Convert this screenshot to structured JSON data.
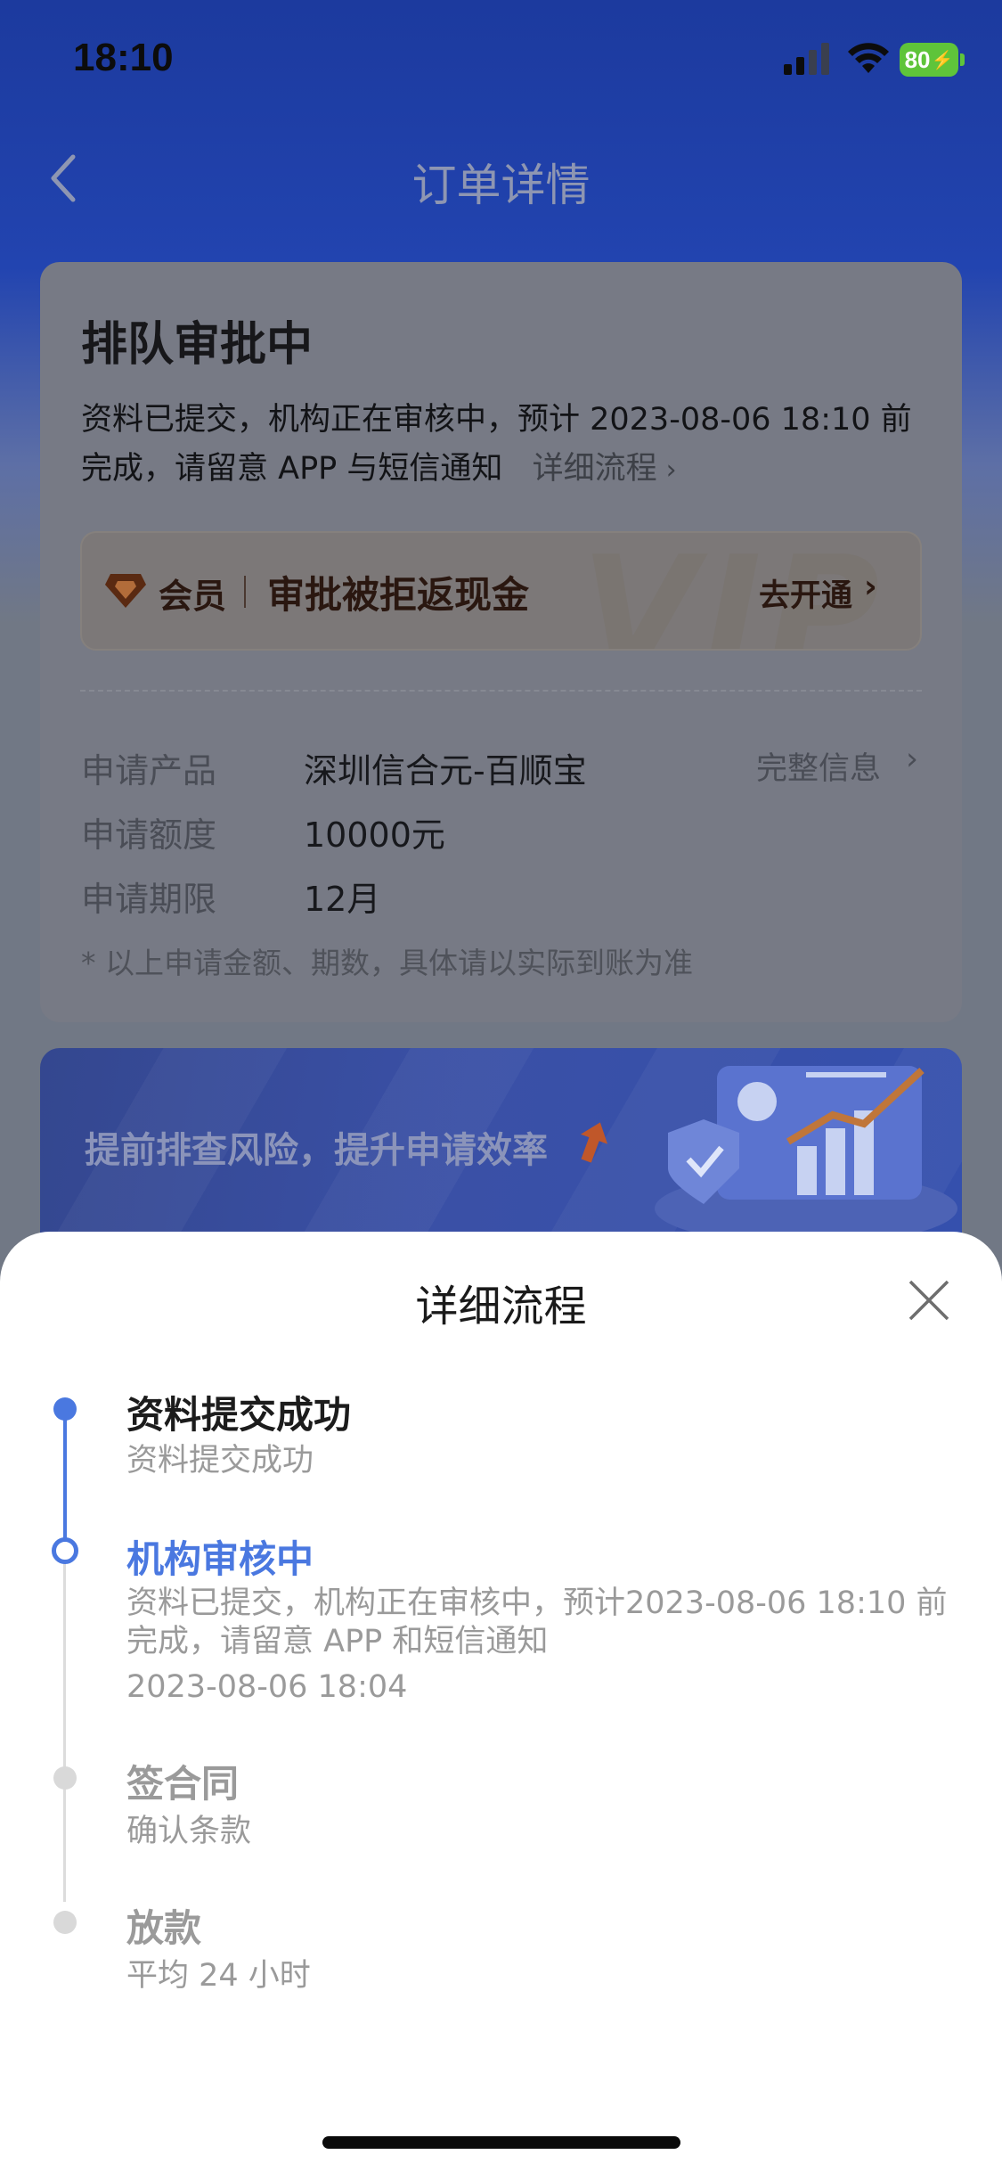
{
  "status_bar": {
    "time": "18:10",
    "battery": "80",
    "icons": [
      "signal-icon",
      "wifi-icon",
      "battery-icon"
    ]
  },
  "nav": {
    "title": "订单详情",
    "back_icon": "chevron-left-icon"
  },
  "order": {
    "status_title": "排队审批中",
    "status_desc": "资料已提交，机构正在审核中，预计 2023-08-06 18:10 前完成，请留意 APP 与短信通知",
    "detail_link": "详细流程",
    "vip": {
      "label": "会员",
      "text": "审批被拒返现金",
      "cta": "去开通",
      "watermark": "VIP",
      "icon": "diamond-icon"
    },
    "info": [
      {
        "key": "申请产品",
        "value": "深圳信合元-百顺宝"
      },
      {
        "key": "申请额度",
        "value": "10000元"
      },
      {
        "key": "申请期限",
        "value": "12月"
      }
    ],
    "full_info_link": "完整信息",
    "note": "* 以上申请金额、期数，具体请以实际到账为准"
  },
  "promo": {
    "text": "提前排查风险，提升申请效率"
  },
  "sheet": {
    "title": "详细流程",
    "steps": [
      {
        "title": "资料提交成功",
        "desc": "资料提交成功",
        "state": "done"
      },
      {
        "title": "机构审核中",
        "desc": "资料已提交，机构正在审核中，预计2023-08-06 18:10 前完成，请留意 APP 和短信通知",
        "time": "2023-08-06 18:04",
        "state": "current"
      },
      {
        "title": "签合同",
        "desc": "确认条款",
        "state": "pending"
      },
      {
        "title": "放款",
        "desc": "平均 24 小时",
        "state": "pending"
      }
    ]
  },
  "colors": {
    "accent": "#4a78e0",
    "header_blue": "#2244b0",
    "overlay": "#717885",
    "vip_text": "#2a1710"
  }
}
